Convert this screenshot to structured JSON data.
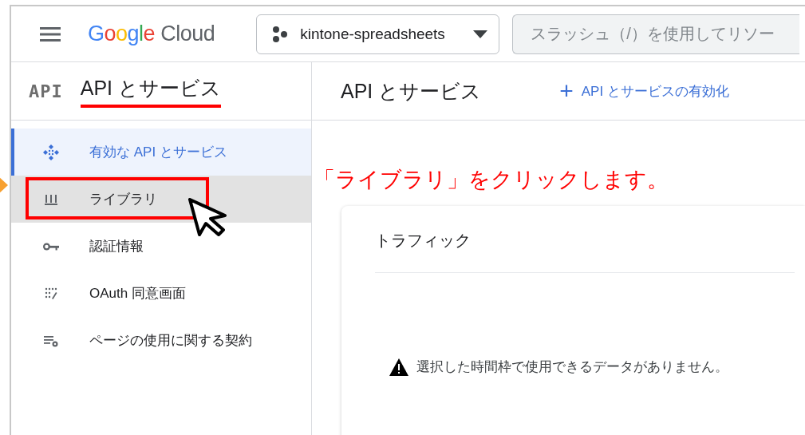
{
  "header": {
    "logo": {
      "brand": "Google",
      "product": "Cloud"
    },
    "project": "kintone-spreadsheets",
    "search": {
      "placeholder": "スラッシュ（/）を使用してリソー"
    }
  },
  "sidebar": {
    "logo_text": "API",
    "title": "API とサービス",
    "title_underlined": true,
    "items": [
      {
        "label": "有効な API とサービス",
        "selected": true,
        "hovered": false,
        "highlighted": false
      },
      {
        "label": "ライブラリ",
        "selected": false,
        "hovered": true,
        "highlighted": true
      },
      {
        "label": "認証情報",
        "selected": false,
        "hovered": false,
        "highlighted": false
      },
      {
        "label": "OAuth 同意画面",
        "selected": false,
        "hovered": false,
        "highlighted": false
      },
      {
        "label": "ページの使用に関する契約",
        "selected": false,
        "hovered": false,
        "highlighted": false
      }
    ]
  },
  "main": {
    "title": "API とサービス",
    "enable_button": {
      "icon": "+",
      "label": "API とサービスの有効化"
    },
    "card": {
      "title": "トラフィック",
      "message": "選択した時間枠で使用できるデータがありません。"
    }
  },
  "annotation": {
    "text": "「ライブラリ」をクリックします。"
  }
}
